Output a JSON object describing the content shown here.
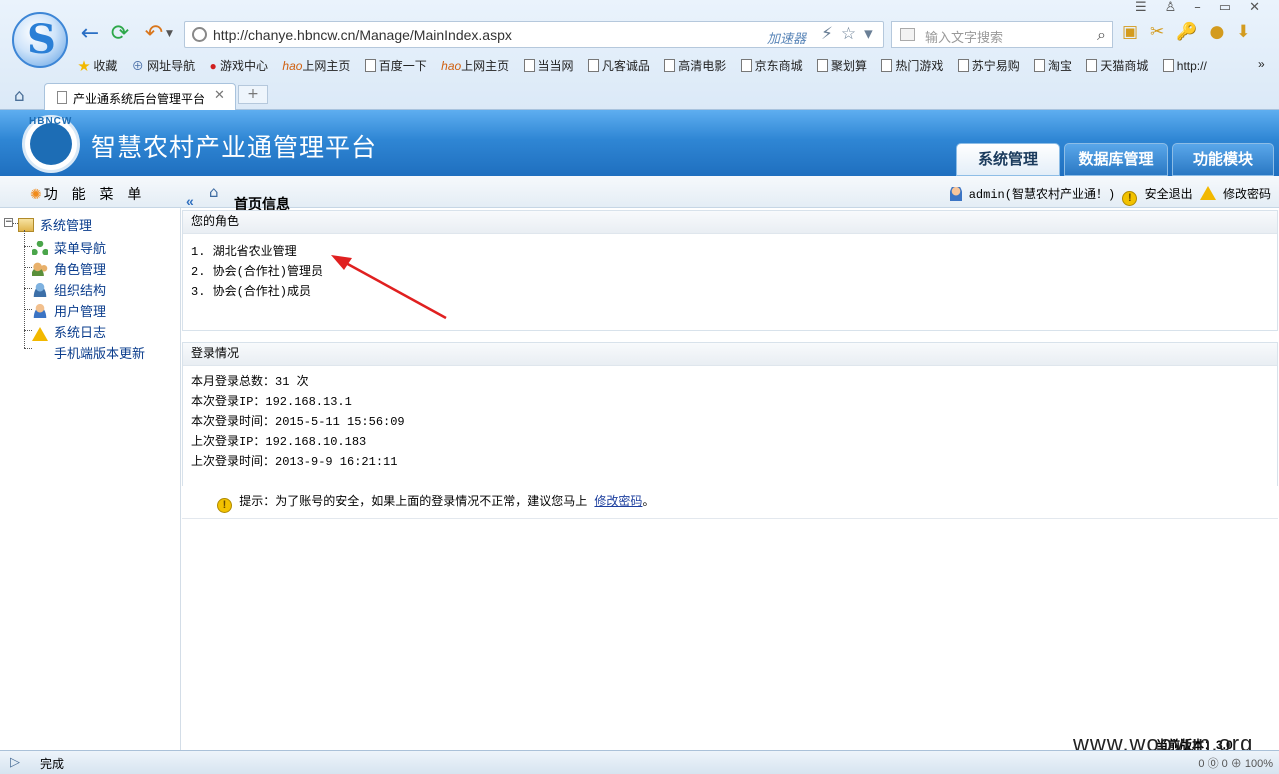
{
  "browser": {
    "url": "http://chanye.hbncw.cn/Manage/MainIndex.aspx",
    "accelerator": "加速器",
    "search_placeholder": "输入文字搜索",
    "bookmarks": [
      "收藏",
      "网址导航",
      "游戏中心",
      "上网主页",
      "百度一下",
      "上网主页",
      "当当网",
      "凡客诚品",
      "高清电影",
      "京东商城",
      "聚划算",
      "热门游戏",
      "苏宁易购",
      "淘宝",
      "天猫商城",
      "http://"
    ],
    "tab_title": "产业通系统后台管理平台",
    "new_tab": "+",
    "status": "完成",
    "status_right": "0 ⓪ 0 ⊕ 100%"
  },
  "app": {
    "logo_text": "HBNCW",
    "title": "智慧农村产业通管理平台",
    "tabs": [
      "系统管理",
      "数据库管理",
      "功能模块"
    ],
    "menu_title": "功 能 菜 单",
    "collapse_label": "«",
    "page_title": "首页信息",
    "user": "admin(智慧农村产业通！)",
    "logout": "安全退出",
    "change_password": "修改密码"
  },
  "sidebar": {
    "root": "系统管理",
    "items": [
      {
        "label": "菜单导航",
        "icon": "sitemap-icon"
      },
      {
        "label": "角色管理",
        "icon": "users-icon"
      },
      {
        "label": "组织结构",
        "icon": "org-icon"
      },
      {
        "label": "用户管理",
        "icon": "user-icon"
      },
      {
        "label": "系统日志",
        "icon": "warning-icon"
      },
      {
        "label": "手机端版本更新",
        "icon": ""
      }
    ]
  },
  "roles": {
    "header": "您的角色",
    "items": [
      "1. 湖北省农业管理",
      "2. 协会(合作社)管理员",
      "3. 协会(合作社)成员"
    ]
  },
  "login": {
    "header": "登录情况",
    "lines": [
      "本月登录总数：31 次",
      "本次登录IP：192.168.13.1",
      "本次登录时间：2015-5-11 15:56:09",
      "上次登录IP：192.168.10.183",
      "上次登录时间：2013-9-9 16:21:11"
    ],
    "hint_text": "提示：为了账号的安全，如果上面的登录情况不正常，建议您马上 ",
    "hint_link": "修改密码",
    "hint_end": "。"
  },
  "footer": {
    "version": "当前版本：3.0",
    "watermark": "www.wooyun.org"
  },
  "colors": {
    "header_blue": "#2f86d4",
    "link_blue": "#0a3c8c",
    "arrow_red": "#e02020"
  }
}
